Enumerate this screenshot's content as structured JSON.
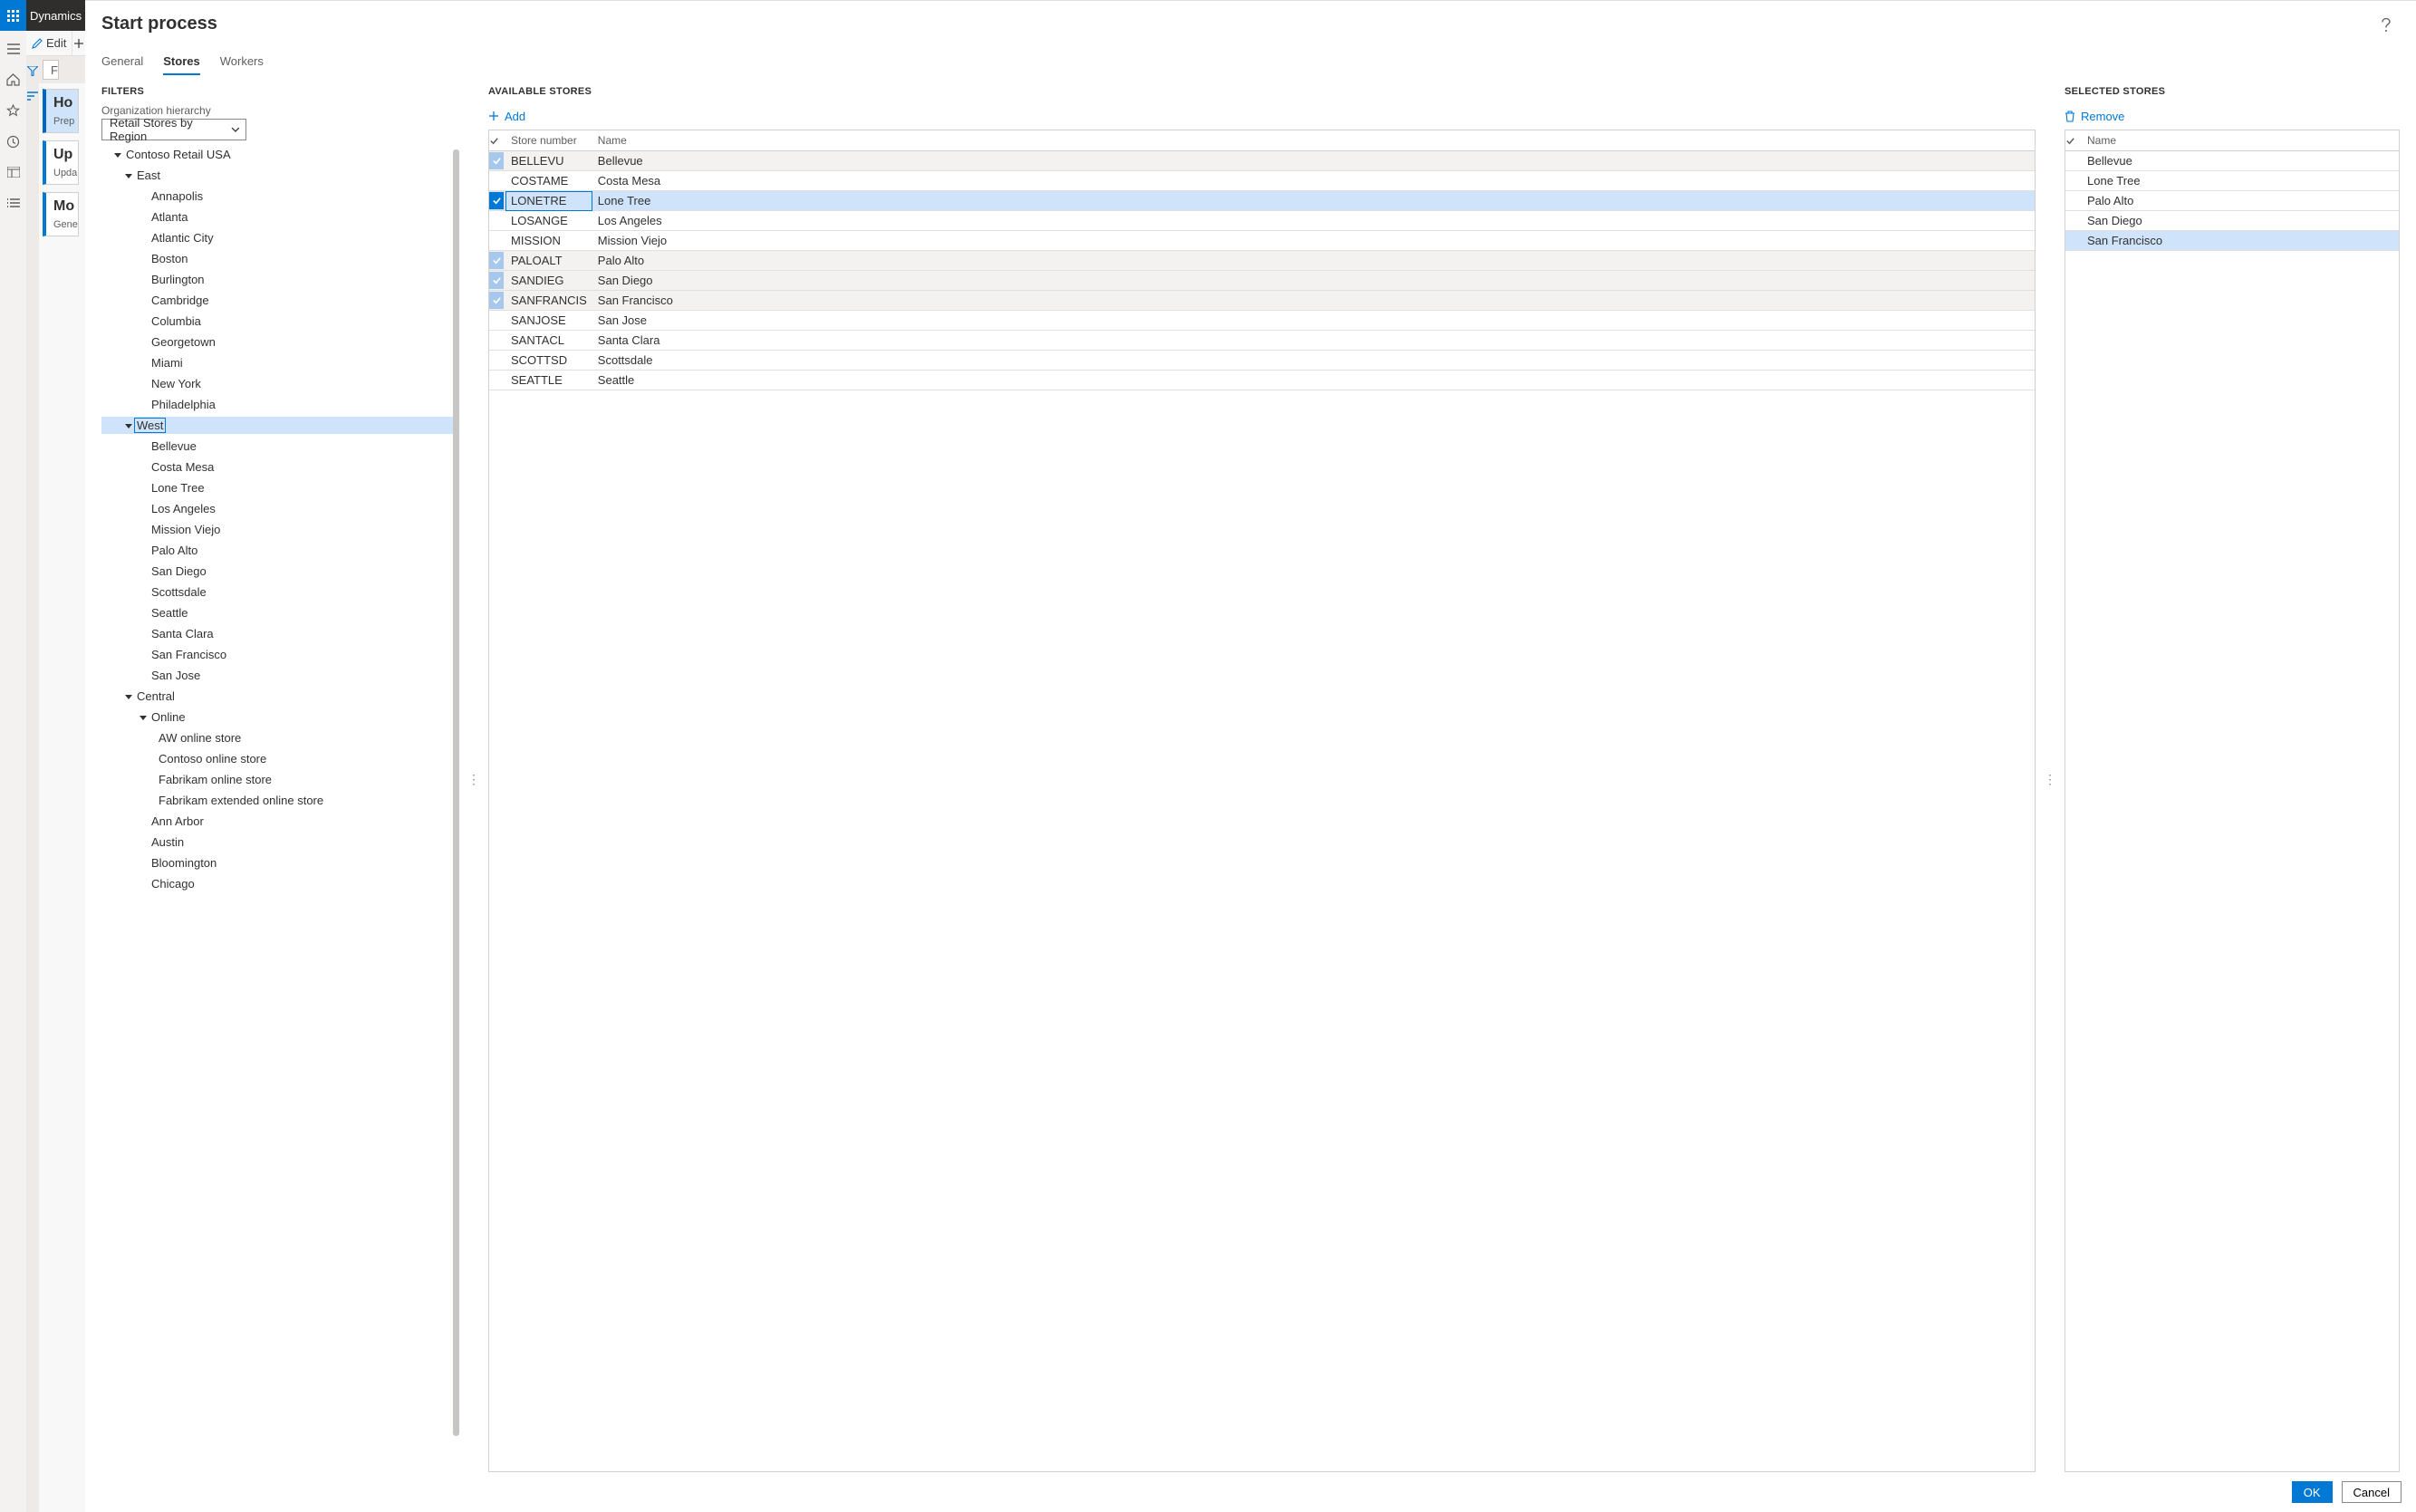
{
  "brand": {
    "name": "Dynamics"
  },
  "toolbar": {
    "edit_label": "Edit"
  },
  "search_placeholder": "Fi",
  "cards": [
    {
      "title": "Ho",
      "sub": "Prep",
      "selected": true
    },
    {
      "title": "Up",
      "sub": "Upda",
      "selected": false
    },
    {
      "title": "Mo",
      "sub": "Gene",
      "selected": false
    }
  ],
  "modal": {
    "title": "Start process",
    "tabs": [
      {
        "label": "General",
        "active": false
      },
      {
        "label": "Stores",
        "active": true
      },
      {
        "label": "Workers",
        "active": false
      }
    ],
    "filters": {
      "section": "FILTERS",
      "field_label": "Organization hierarchy",
      "dropdown_value": "Retail Stores by Region"
    },
    "tree": [
      {
        "label": "Contoso Retail USA",
        "indent": 0,
        "caret": "up"
      },
      {
        "label": "East",
        "indent": 1,
        "caret": "open"
      },
      {
        "label": "Annapolis",
        "indent": 2
      },
      {
        "label": "Atlanta",
        "indent": 2
      },
      {
        "label": "Atlantic City",
        "indent": 2
      },
      {
        "label": "Boston",
        "indent": 2
      },
      {
        "label": "Burlington",
        "indent": 2
      },
      {
        "label": "Cambridge",
        "indent": 2
      },
      {
        "label": "Columbia",
        "indent": 2
      },
      {
        "label": "Georgetown",
        "indent": 2
      },
      {
        "label": "Miami",
        "indent": 2
      },
      {
        "label": "New York",
        "indent": 2
      },
      {
        "label": "Philadelphia",
        "indent": 2
      },
      {
        "label": "West",
        "indent": 1,
        "caret": "open",
        "selected": true
      },
      {
        "label": "Bellevue",
        "indent": 2
      },
      {
        "label": "Costa Mesa",
        "indent": 2
      },
      {
        "label": "Lone Tree",
        "indent": 2
      },
      {
        "label": "Los Angeles",
        "indent": 2
      },
      {
        "label": "Mission Viejo",
        "indent": 2
      },
      {
        "label": "Palo Alto",
        "indent": 2
      },
      {
        "label": "San Diego",
        "indent": 2
      },
      {
        "label": "Scottsdale",
        "indent": 2
      },
      {
        "label": "Seattle",
        "indent": 2
      },
      {
        "label": "Santa Clara",
        "indent": 2
      },
      {
        "label": "San Francisco",
        "indent": 2
      },
      {
        "label": "San Jose",
        "indent": 2
      },
      {
        "label": "Central",
        "indent": 1,
        "caret": "open"
      },
      {
        "label": "Online",
        "indent": 2,
        "caret": "open"
      },
      {
        "label": "AW online store",
        "indent": 3
      },
      {
        "label": "Contoso online store",
        "indent": 3
      },
      {
        "label": "Fabrikam online store",
        "indent": 3
      },
      {
        "label": "Fabrikam extended online store",
        "indent": 3
      },
      {
        "label": "Ann Arbor",
        "indent": 2
      },
      {
        "label": "Austin",
        "indent": 2
      },
      {
        "label": "Bloomington",
        "indent": 2
      },
      {
        "label": "Chicago",
        "indent": 2
      }
    ],
    "available": {
      "section": "AVAILABLE STORES",
      "add_label": "Add",
      "columns": [
        "Store number",
        "Name"
      ],
      "rows": [
        {
          "num": "BELLEVU",
          "name": "Bellevue",
          "checked": "soft"
        },
        {
          "num": "COSTAME",
          "name": "Costa Mesa"
        },
        {
          "num": "LONETRE",
          "name": "Lone Tree",
          "checked": "strong",
          "focus": true
        },
        {
          "num": "LOSANGE",
          "name": "Los Angeles"
        },
        {
          "num": "MISSION",
          "name": "Mission Viejo"
        },
        {
          "num": "PALOALT",
          "name": "Palo Alto",
          "checked": "soft"
        },
        {
          "num": "SANDIEG",
          "name": "San Diego",
          "checked": "soft"
        },
        {
          "num": "SANFRANCIS",
          "name": "San Francisco",
          "checked": "soft"
        },
        {
          "num": "SANJOSE",
          "name": "San Jose"
        },
        {
          "num": "SANTACL",
          "name": "Santa Clara"
        },
        {
          "num": "SCOTTSD",
          "name": "Scottsdale"
        },
        {
          "num": "SEATTLE",
          "name": "Seattle"
        }
      ]
    },
    "selected": {
      "section": "SELECTED STORES",
      "remove_label": "Remove",
      "columns": [
        "Name"
      ],
      "rows": [
        {
          "name": "Bellevue"
        },
        {
          "name": "Lone Tree"
        },
        {
          "name": "Palo Alto"
        },
        {
          "name": "San Diego"
        },
        {
          "name": "San Francisco",
          "highlight": true
        }
      ]
    },
    "footer": {
      "ok": "OK",
      "cancel": "Cancel"
    }
  }
}
